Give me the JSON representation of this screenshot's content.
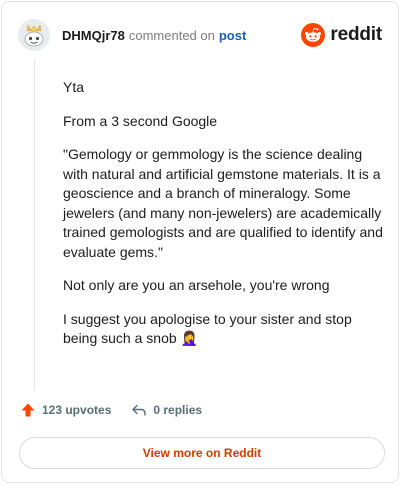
{
  "header": {
    "username": "DHMQjr78",
    "commented_on": "commented on",
    "post_link": "post",
    "brand": "reddit"
  },
  "comment": {
    "paragraphs": [
      "Yta",
      "From a 3 second Google",
      "\"Gemology or gemmology is the science dealing with natural and artificial gemstone materials. It is a geoscience and a branch of mineralogy. Some jewelers (and many non-jewelers) are academically trained gemologists and are qualified to identify and evaluate gems.\"",
      "Not only are you an arsehole, you're wrong",
      "I suggest you apologise to your sister and stop being such a snob 🤦‍♀️"
    ]
  },
  "actions": {
    "upvotes": "123 upvotes",
    "replies": "0 replies"
  },
  "footer": {
    "view_more": "View more on Reddit"
  },
  "colors": {
    "brand": "#ff4500",
    "link": "#1a5fb4",
    "view_more": "#d93a00"
  }
}
